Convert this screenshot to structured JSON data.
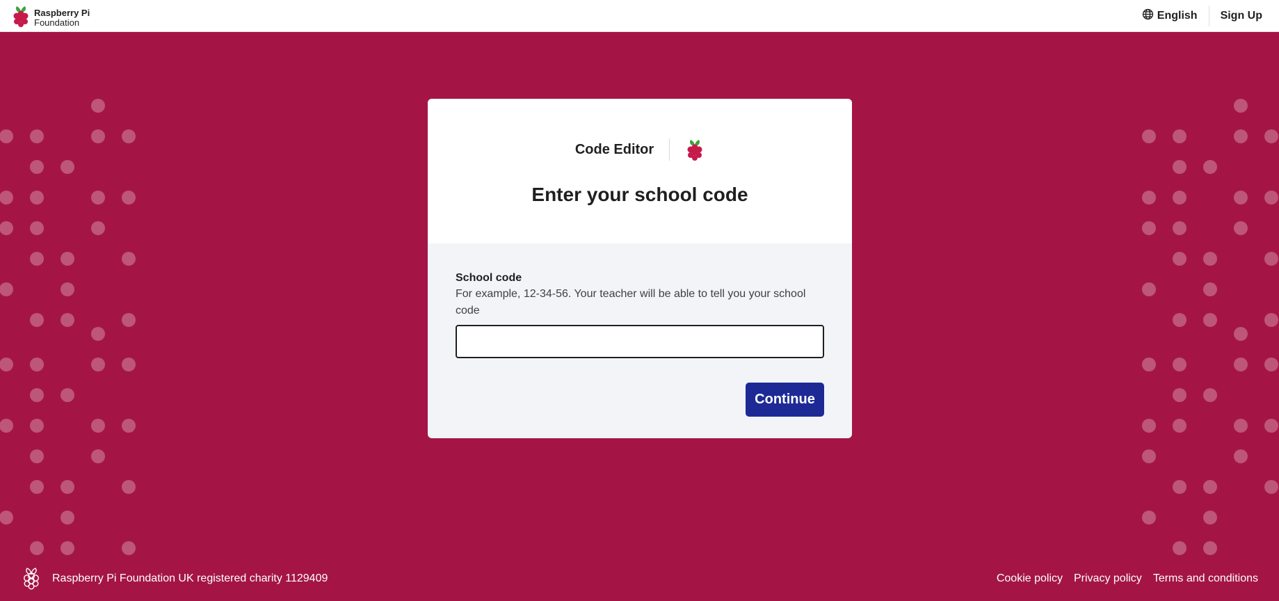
{
  "header": {
    "brand_line1": "Raspberry Pi",
    "brand_line2": "Foundation",
    "language_label": "English",
    "signup_label": "Sign Up"
  },
  "card": {
    "product_name": "Code Editor",
    "title": "Enter your school code",
    "field_label": "School code",
    "field_hint": "For example, 12-34-56. Your teacher will be able to tell you your school code",
    "field_value": "",
    "continue_label": "Continue"
  },
  "footer": {
    "charity_text": "Raspberry Pi Foundation UK registered charity 1129409",
    "links": [
      "Cookie policy",
      "Privacy policy",
      "Terms and conditions"
    ]
  },
  "colors": {
    "background": "#a41545",
    "button": "#1d2a96",
    "card_body": "#f3f4f8"
  },
  "icons": {
    "brand": "raspberry-pi-logo",
    "language": "globe-icon"
  }
}
